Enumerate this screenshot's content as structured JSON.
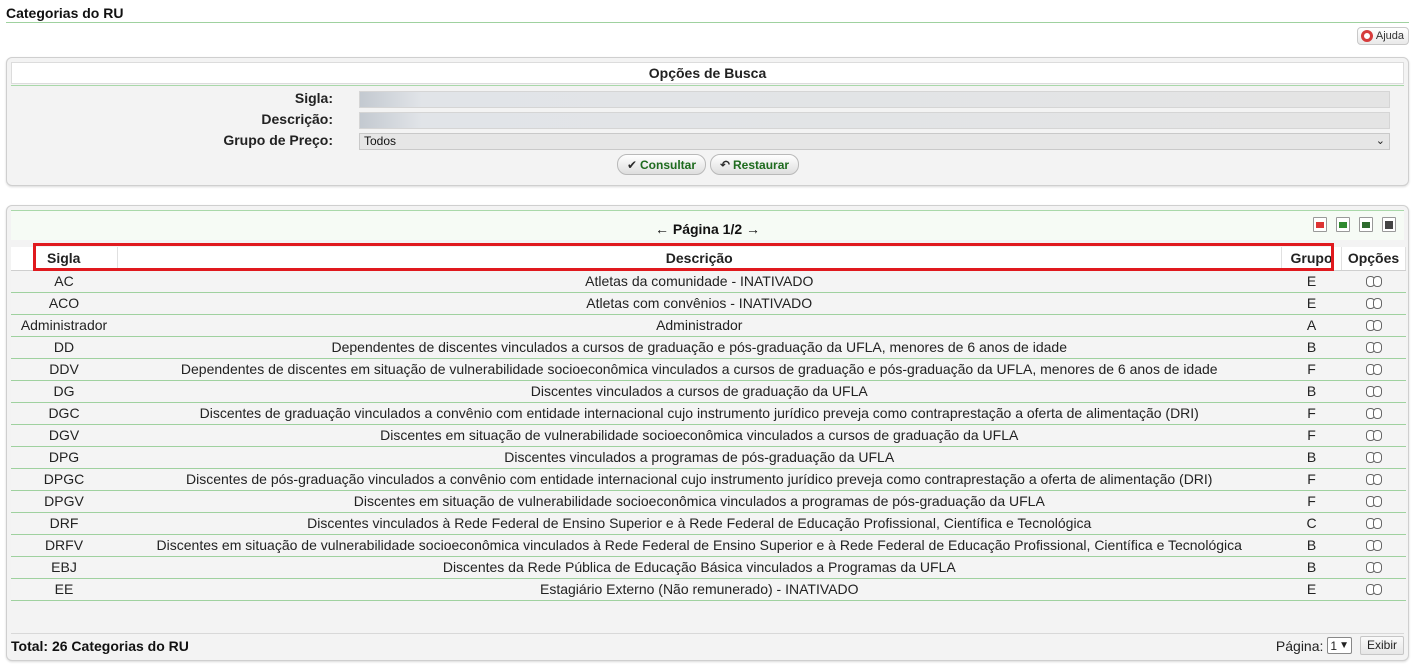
{
  "page": {
    "title": "Categorias do RU",
    "help_label": "Ajuda"
  },
  "search": {
    "title": "Opções de Busca",
    "sigla_label": "Sigla:",
    "descricao_label": "Descrição:",
    "grupo_label": "Grupo de Preço:",
    "grupo_value": "Todos",
    "consultar_label": "Consultar",
    "restaurar_label": "Restaurar"
  },
  "results": {
    "pagination": "← Página 1/2 →",
    "columns": {
      "sigla": "Sigla",
      "descricao": "Descrição",
      "grupo": "Grupo",
      "opcoes": "Opções"
    },
    "rows": [
      {
        "sigla": "AC",
        "descricao": "Atletas da comunidade - INATIVADO",
        "grupo": "E"
      },
      {
        "sigla": "ACO",
        "descricao": "Atletas com convênios - INATIVADO",
        "grupo": "E"
      },
      {
        "sigla": "Administrador",
        "descricao": "Administrador",
        "grupo": "A"
      },
      {
        "sigla": "DD",
        "descricao": "Dependentes de discentes vinculados a cursos de graduação e pós-graduação da UFLA, menores de 6 anos de idade",
        "grupo": "B"
      },
      {
        "sigla": "DDV",
        "descricao": "Dependentes de discentes em situação de vulnerabilidade socioeconômica vinculados a cursos de graduação e pós-graduação da UFLA, menores de 6 anos de idade",
        "grupo": "F"
      },
      {
        "sigla": "DG",
        "descricao": "Discentes vinculados a cursos de graduação da UFLA",
        "grupo": "B"
      },
      {
        "sigla": "DGC",
        "descricao": "Discentes de graduação vinculados a convênio com entidade internacional cujo instrumento jurídico preveja como contraprestação a oferta de alimentação (DRI)",
        "grupo": "F"
      },
      {
        "sigla": "DGV",
        "descricao": "Discentes em situação de vulnerabilidade socioeconômica vinculados a cursos de graduação da UFLA",
        "grupo": "F"
      },
      {
        "sigla": "DPG",
        "descricao": "Discentes vinculados a programas de pós-graduação da UFLA",
        "grupo": "B"
      },
      {
        "sigla": "DPGC",
        "descricao": "Discentes de pós-graduação vinculados a convênio com entidade internacional cujo instrumento jurídico preveja como contraprestação a oferta de alimentação (DRI)",
        "grupo": "F"
      },
      {
        "sigla": "DPGV",
        "descricao": "Discentes em situação de vulnerabilidade socioeconômica vinculados a programas de pós-graduação da UFLA",
        "grupo": "F"
      },
      {
        "sigla": "DRF",
        "descricao": "Discentes vinculados à Rede Federal de Ensino Superior e à Rede Federal de Educação Profissional, Científica e Tecnológica",
        "grupo": "C"
      },
      {
        "sigla": "DRFV",
        "descricao": "Discentes em situação de vulnerabilidade socioeconômica vinculados à Rede Federal de Ensino Superior e à Rede Federal de Educação Profissional, Científica e Tecnológica",
        "grupo": "B"
      },
      {
        "sigla": "EBJ",
        "descricao": "Discentes da Rede Pública de Educação Básica vinculados a Programas da UFLA",
        "grupo": "B"
      },
      {
        "sigla": "EE",
        "descricao": "Estagiário Externo (Não remunerado) - INATIVADO",
        "grupo": "E"
      }
    ],
    "total": "Total: 26 Categorias do RU",
    "page_label": "Página:",
    "page_value": "1",
    "exibir_label": "Exibir"
  },
  "colors": {
    "accent_green": "#1e6b1e",
    "rule_green": "#9fd19f",
    "highlight_red": "#e0191e"
  },
  "icons": {
    "help": "lifebuoy-icon",
    "consultar": "checkmark-icon",
    "restaurar": "undo-icon",
    "row_option": "binoculars-icon"
  }
}
